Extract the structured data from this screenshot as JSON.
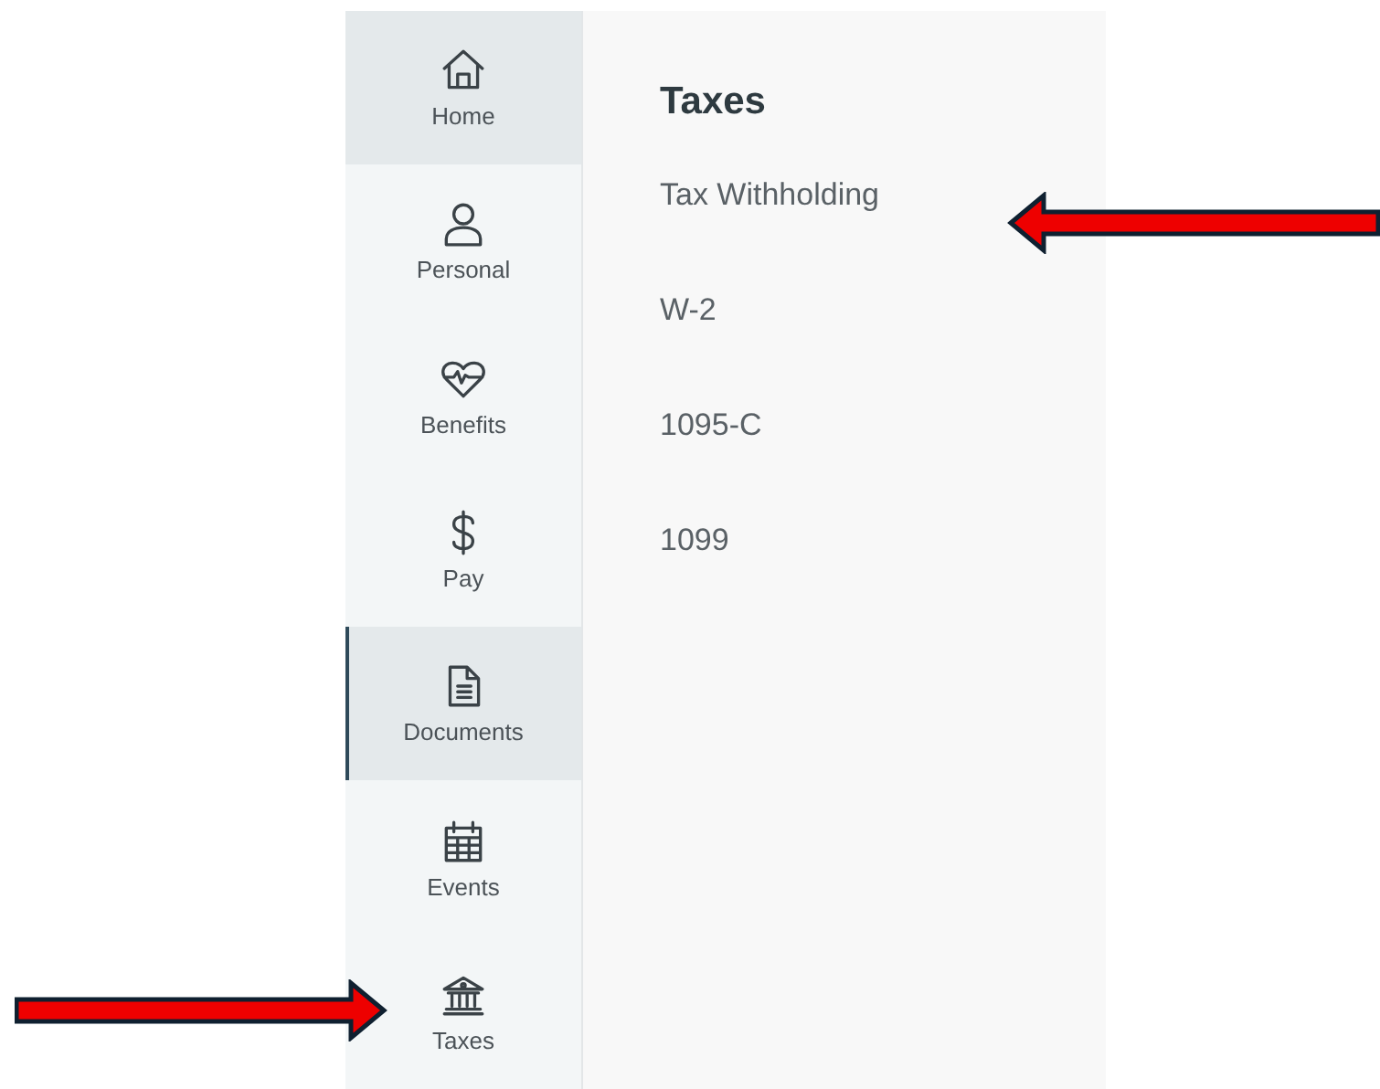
{
  "sidebar": {
    "items": [
      {
        "label": "Home",
        "selected": false,
        "highlighted": true
      },
      {
        "label": "Personal",
        "selected": false,
        "highlighted": false
      },
      {
        "label": "Benefits",
        "selected": false,
        "highlighted": false
      },
      {
        "label": "Pay",
        "selected": false,
        "highlighted": false
      },
      {
        "label": "Documents",
        "selected": true,
        "highlighted": true
      },
      {
        "label": "Events",
        "selected": false,
        "highlighted": false
      },
      {
        "label": "Taxes",
        "selected": false,
        "highlighted": false
      }
    ]
  },
  "panel": {
    "title": "Taxes",
    "links": [
      "Tax Withholding",
      "W-2",
      "1095-C",
      "1099"
    ]
  }
}
